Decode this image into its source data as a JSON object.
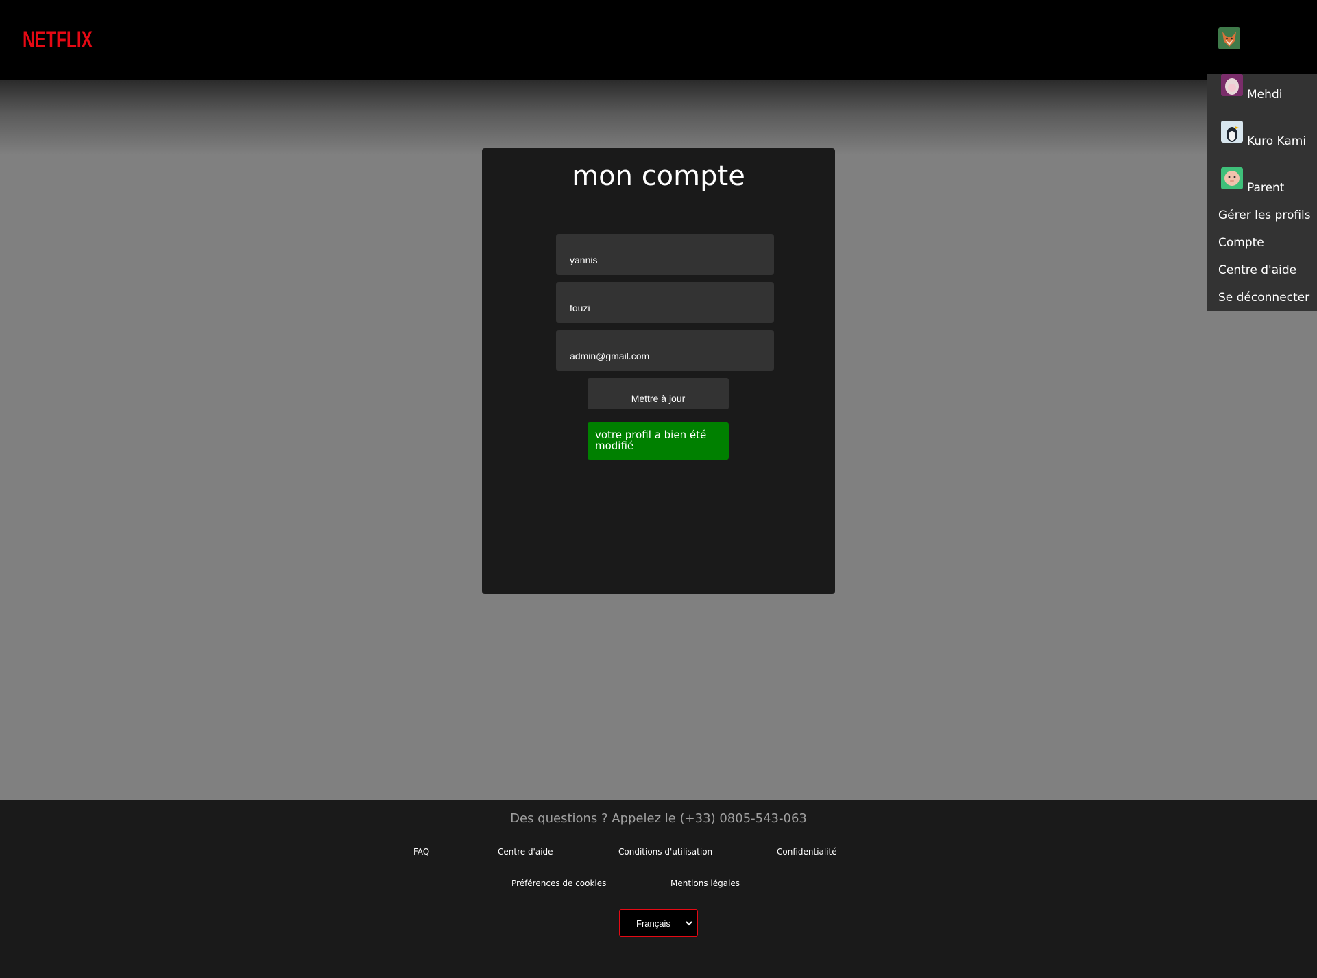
{
  "header": {
    "logo_text": "NETFLIX",
    "brand_color": "#e50914"
  },
  "dropdown": {
    "profiles": [
      {
        "name": "Mehdi",
        "icon": "mehdi-avatar-icon"
      },
      {
        "name": "Kuro Kami",
        "icon": "kuro-kami-avatar-icon"
      },
      {
        "name": "Parent",
        "icon": "parent-avatar-icon"
      }
    ],
    "links": [
      "Gérer les profils",
      "Compte",
      "Centre d'aide",
      "Se déconnecter"
    ]
  },
  "card": {
    "title": "mon compte",
    "fields": [
      "yannis",
      "fouzi",
      "admin@gmail.com"
    ],
    "update_label": "Mettre à jour",
    "success_message": "votre profil a bien été modifié",
    "success_color": "#008000"
  },
  "footer": {
    "phone": "Des questions ? Appelez le (+33) 0805-543-063",
    "links_row1": [
      "FAQ",
      "Centre d'aide",
      "Conditions d'utilisation",
      "Confidentialité"
    ],
    "links_row2": [
      "Préférences de cookies",
      "Mentions légales"
    ],
    "language": "Français"
  }
}
